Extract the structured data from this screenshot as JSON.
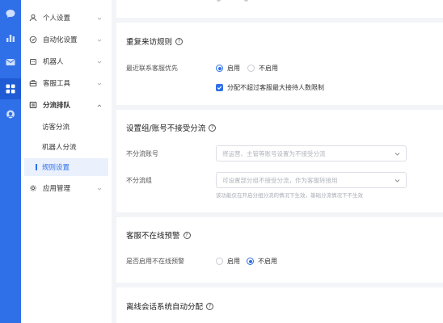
{
  "rail": {
    "items": [
      {
        "icon": "chat-bubble-icon"
      },
      {
        "icon": "bar-chart-icon"
      },
      {
        "icon": "mail-icon"
      },
      {
        "icon": "apps-grid-icon"
      },
      {
        "icon": "agent-headset-icon"
      }
    ],
    "active_index": 3,
    "color": "#2f6fe8"
  },
  "menu": {
    "items": [
      {
        "label": "个人设置",
        "icon": "user-icon"
      },
      {
        "label": "自动化设置",
        "icon": "automation-icon"
      },
      {
        "label": "机器人",
        "icon": "robot-icon"
      },
      {
        "label": "客服工具",
        "icon": "toolbox-icon"
      },
      {
        "label": "分流排队",
        "icon": "queue-icon",
        "expanded": true
      },
      {
        "label": "应用管理",
        "icon": "app-settings-icon"
      }
    ],
    "subitems": [
      {
        "label": "访客分流"
      },
      {
        "label": "机器人分流"
      },
      {
        "label": "规则设置",
        "active": true
      }
    ]
  },
  "sections": {
    "repeat": {
      "title": "重复来访规则",
      "priority_label": "最近联系客服优先",
      "enable_label": "启用",
      "disable_label": "不启用",
      "selected": "启用",
      "checkbox_label": "分配不超过客服最大接待人数限制",
      "checkbox_checked": true
    },
    "exclude": {
      "title": "设置组/账号不接受分流",
      "account_label": "不分流账号",
      "account_placeholder": "将运营、主管等账号设置为不接受分流",
      "group_label": "不分流组",
      "group_placeholder": "可设置部分组不接受分流，作为客服转接用",
      "hint": "该功能仅在开启分组分流的情况下生效，基础分流情况下不生效"
    },
    "offline": {
      "title": "客服不在线预警",
      "enable_q_label": "是否启用不在线预警",
      "enable_label": "启用",
      "disable_label": "不启用",
      "selected": "不启用"
    },
    "offline_session": {
      "title": "离线会话系统自动分配"
    }
  }
}
